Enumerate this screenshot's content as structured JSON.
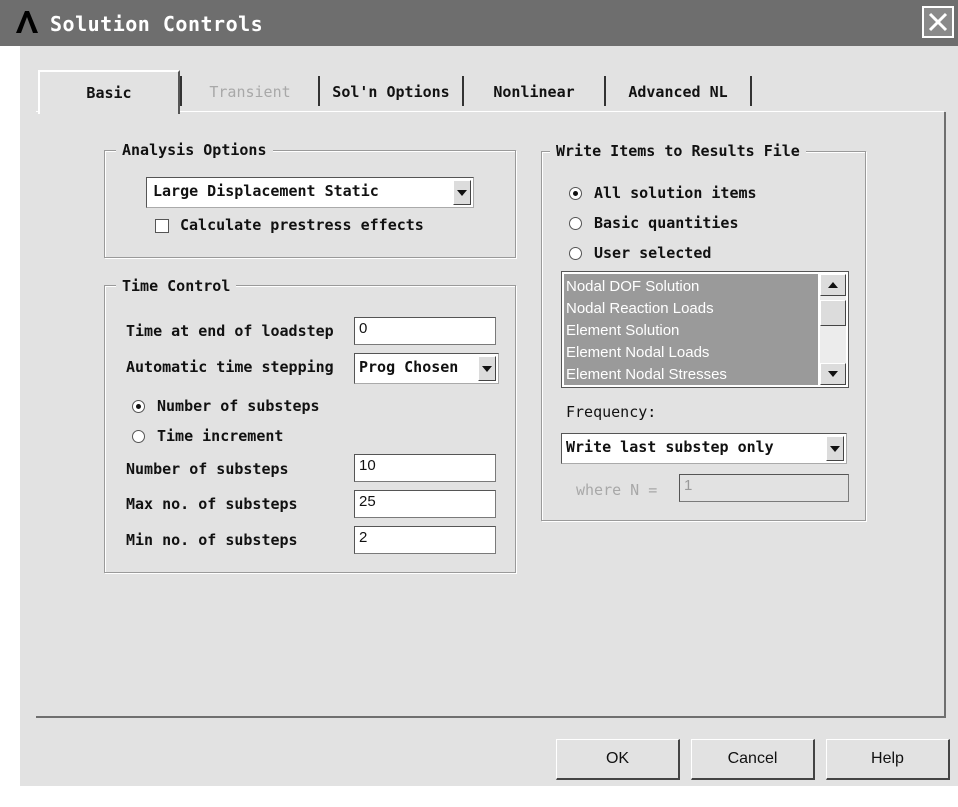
{
  "window": {
    "title": "Solution Controls",
    "app_icon": "ansys-logo-icon",
    "close_icon": "close-icon"
  },
  "tabs": [
    {
      "label": "Basic",
      "state": "selected"
    },
    {
      "label": "Transient",
      "state": "disabled"
    },
    {
      "label": "Sol'n Options",
      "state": "normal"
    },
    {
      "label": "Nonlinear",
      "state": "normal"
    },
    {
      "label": "Advanced NL",
      "state": "normal"
    }
  ],
  "analysis_options": {
    "group_label": "Analysis Options",
    "analysis_type": "Large Displacement Static",
    "prestress_label": "Calculate prestress effects",
    "prestress_checked": false
  },
  "time_control": {
    "group_label": "Time Control",
    "time_end_label": "Time at end of loadstep",
    "time_end_value": "0",
    "auto_step_label": "Automatic time stepping",
    "auto_step_value": "Prog Chosen",
    "radio_substeps_label": "Number of substeps",
    "radio_increment_label": "Time increment",
    "selected_radio": "Number of substeps",
    "num_substeps_label": "Number of substeps",
    "num_substeps_value": "10",
    "max_substeps_label": "Max no. of substeps",
    "max_substeps_value": "25",
    "min_substeps_label": "Min no. of substeps",
    "min_substeps_value": "2"
  },
  "results_file": {
    "group_label": "Write Items to Results File",
    "radio_all_label": "All solution items",
    "radio_basic_label": "Basic quantities",
    "radio_user_label": "User selected",
    "selected_radio": "All solution items",
    "list_items": [
      "Nodal DOF Solution",
      "Nodal Reaction Loads",
      "Element Solution",
      "Element Nodal Loads",
      "Element Nodal Stresses"
    ],
    "frequency_label": "Frequency:",
    "frequency_value": "Write last substep only",
    "where_label": "where N =",
    "where_value": "1"
  },
  "buttons": {
    "ok": "OK",
    "cancel": "Cancel",
    "help": "Help"
  },
  "colors": {
    "titlebar": "#6e6e6e",
    "dialog_bg": "#e2e2e2",
    "list_bg": "#9a9a9a"
  }
}
